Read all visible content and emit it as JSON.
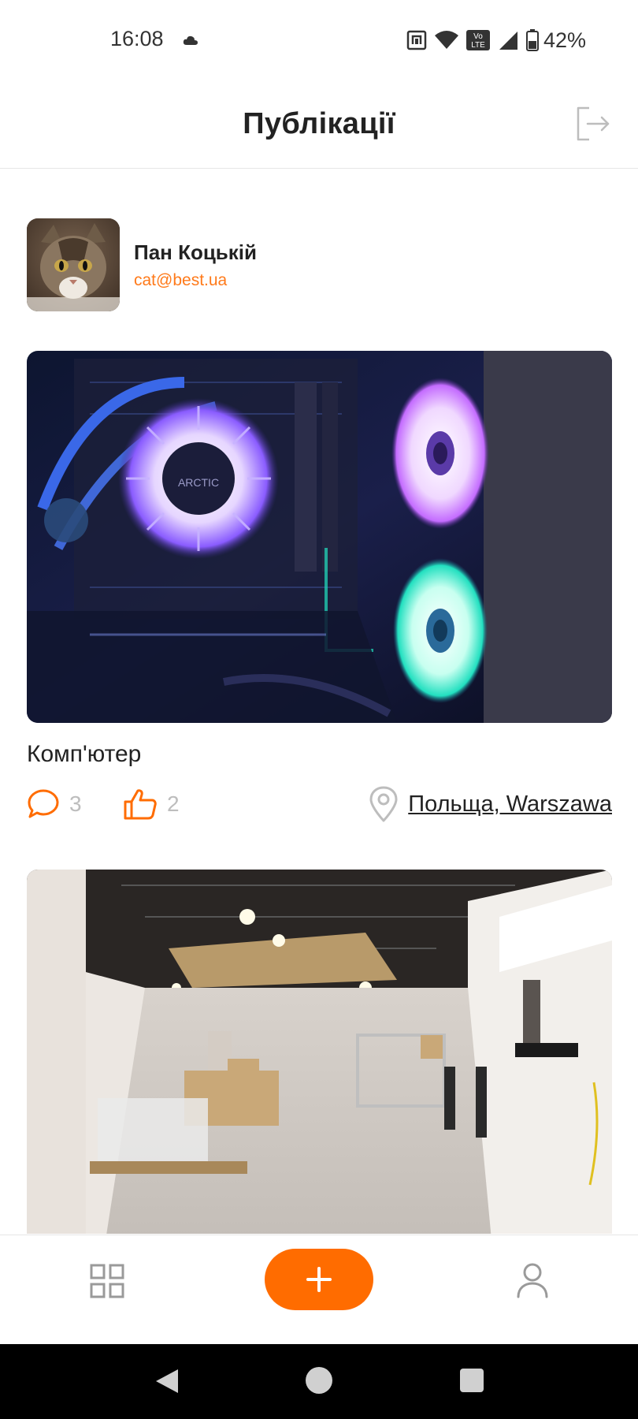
{
  "status_bar": {
    "time": "16:08",
    "battery": "42%",
    "icons": [
      "cloud-icon",
      "nfc-icon",
      "wifi-icon",
      "volte-icon",
      "signal-icon",
      "battery-icon"
    ],
    "volte_label_1": "Vo",
    "volte_label_2": "LTE"
  },
  "header": {
    "title": "Публікації",
    "logout_icon": "logout-icon"
  },
  "user": {
    "name": "Пан Коцькій",
    "email": "cat@best.ua",
    "avatar_icon": "cat-avatar"
  },
  "posts": [
    {
      "image": "pc-case-rgb-photo",
      "image_text": "ARCTIC",
      "title": "Комп'ютер",
      "comments": "3",
      "likes": "2",
      "location": "Польща, Warszawa"
    },
    {
      "image": "room-renovation-photo"
    }
  ],
  "tab_bar": {
    "items": [
      "grid-icon",
      "plus-icon",
      "user-icon"
    ]
  },
  "system_nav": {
    "items": [
      "back-icon",
      "home-icon",
      "recents-icon"
    ]
  },
  "colors": {
    "accent": "#ff6c00",
    "email": "#ff7a1a",
    "muted": "#bdbdbd",
    "text": "#222222"
  }
}
